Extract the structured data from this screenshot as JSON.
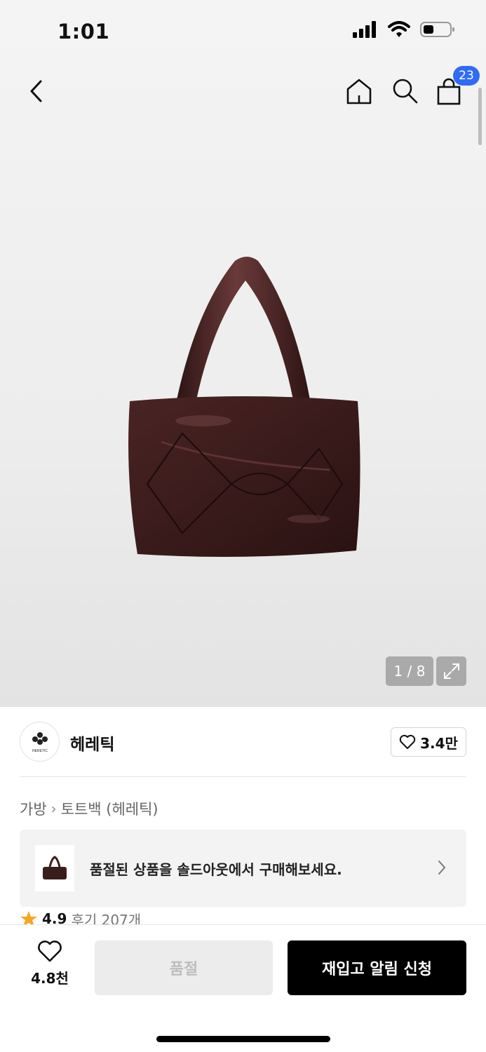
{
  "status_bar": {
    "time": "1:01"
  },
  "header": {
    "cart_count": "23"
  },
  "gallery": {
    "counter": "1 / 8",
    "image_alt": "tote bag"
  },
  "brand": {
    "name": "헤레틱",
    "logo_text": "HERETIC",
    "likes": "3.4만"
  },
  "breadcrumb": {
    "category": "가방",
    "subcategory": "토트백 (헤레틱)"
  },
  "soldout_banner": {
    "text": "품절된 상품을 솔드아웃에서 구매해보세요."
  },
  "rating": {
    "score": "4.9",
    "reviews": "후기 207개"
  },
  "bottom_bar": {
    "wish_count": "4.8천",
    "soldout_label": "품절",
    "restock_label": "재입고 알림 신청"
  },
  "colors": {
    "accent_blue": "#2f6bf5",
    "bag": "#3b1c1c",
    "star": "#f5a623"
  }
}
